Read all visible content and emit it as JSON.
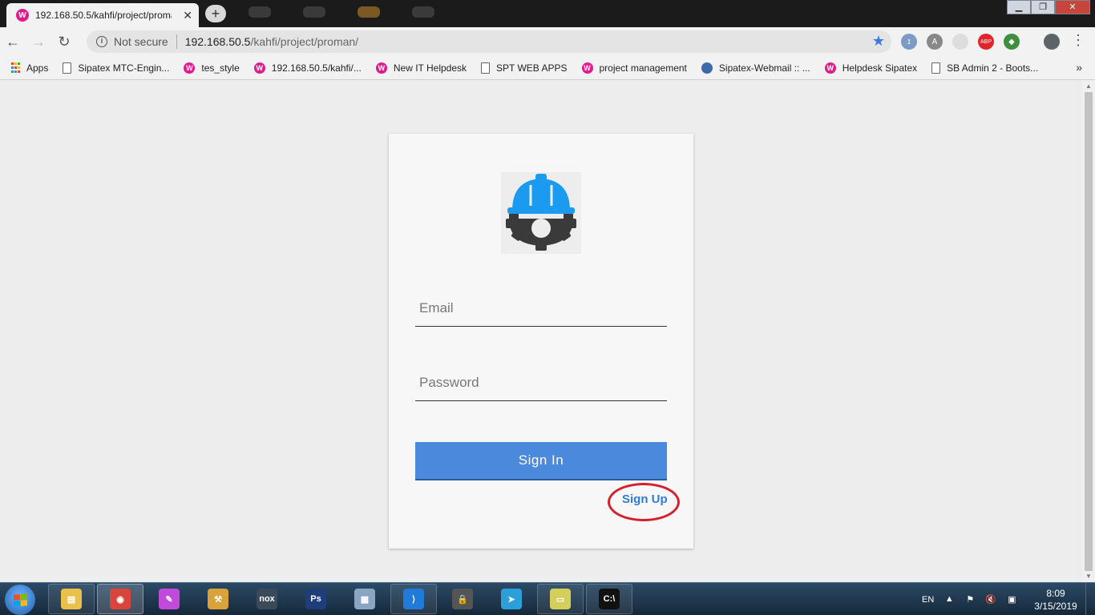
{
  "browser": {
    "tab": {
      "title": "192.168.50.5/kahfi/project/proman/",
      "favicon": "W",
      "close": "✕"
    },
    "new_tab": "+",
    "window_controls": {
      "minimize": "▁",
      "maximize": "❐",
      "close": "✕"
    },
    "nav": {
      "back": "←",
      "forward": "→",
      "reload": "↻"
    },
    "omnibox": {
      "info": "i",
      "security_label": "Not secure",
      "url_host": "192.168.50.5",
      "url_path": "/kahfi/project/proman/",
      "star": "★"
    },
    "extensions": [
      {
        "name": "extension-1-icon",
        "glyph": "ɪ",
        "color": "#7d9cc3"
      },
      {
        "name": "extension-angular-icon",
        "glyph": "A",
        "color": "#888888"
      },
      {
        "name": "extension-3-icon",
        "glyph": "",
        "color": "#dddddd"
      },
      {
        "name": "adblock-plus-icon",
        "glyph": "ABP",
        "color": "#e0262a"
      },
      {
        "name": "extension-5-icon",
        "glyph": "◆",
        "color": "#3f8d3f"
      }
    ],
    "menu": "⋮",
    "bookmarks": {
      "apps_label": "Apps",
      "items": [
        {
          "label": "Sipatex MTC-Engin...",
          "icon": "page"
        },
        {
          "label": "tes_style",
          "icon": "wamp"
        },
        {
          "label": "192.168.50.5/kahfi/...",
          "icon": "wamp"
        },
        {
          "label": "New IT Helpdesk",
          "icon": "wamp"
        },
        {
          "label": "SPT WEB APPS",
          "icon": "page"
        },
        {
          "label": "project management",
          "icon": "wamp"
        },
        {
          "label": "Sipatex-Webmail :: ...",
          "icon": "globe"
        },
        {
          "label": "Helpdesk Sipatex",
          "icon": "wamp"
        },
        {
          "label": "SB Admin 2 - Boots...",
          "icon": "page"
        }
      ],
      "more": "»"
    }
  },
  "login": {
    "logo_name": "hardhat-gear-logo",
    "logo_colors": {
      "helmet": "#1a9bef",
      "gear": "#3a3a3a"
    },
    "email_placeholder": "Email",
    "email_value": "",
    "password_placeholder": "Password",
    "password_value": "",
    "signin_label": "Sign In",
    "signup_label": "Sign Up",
    "accent": "#4a89dc",
    "annotation_color": "#d3202a"
  },
  "taskbar": {
    "items": [
      {
        "name": "file-explorer-icon",
        "glyph": "▤",
        "color": "#e8c04a",
        "state": "pinned"
      },
      {
        "name": "chrome-icon",
        "glyph": "◉",
        "color": "#d9453a",
        "state": "active"
      },
      {
        "name": "paint-icon",
        "glyph": "✎",
        "color": "#c04ad9",
        "state": ""
      },
      {
        "name": "tools-icon",
        "glyph": "⚒",
        "color": "#d9a23a",
        "state": ""
      },
      {
        "name": "nox-icon",
        "glyph": "nox",
        "color": "#3a4a5a",
        "state": ""
      },
      {
        "name": "photoshop-icon",
        "glyph": "Ps",
        "color": "#1e3d7a",
        "state": ""
      },
      {
        "name": "calculator-icon",
        "glyph": "▦",
        "color": "#8aa4c4",
        "state": ""
      },
      {
        "name": "visual-studio-code-icon",
        "glyph": "⟩",
        "color": "#1f7ad8",
        "state": "pinned"
      },
      {
        "name": "security-tool-icon",
        "glyph": "🔒",
        "color": "#555555",
        "state": ""
      },
      {
        "name": "telegram-icon",
        "glyph": "➤",
        "color": "#2a9fd8",
        "state": ""
      },
      {
        "name": "sticky-notes-icon",
        "glyph": "▭",
        "color": "#d4cf5a",
        "state": "pinned"
      },
      {
        "name": "command-prompt-icon",
        "glyph": "C:\\",
        "color": "#111111",
        "state": "pinned"
      }
    ],
    "language": "EN",
    "tray_up": "▲",
    "clock_time": "8:09",
    "clock_date": "3/15/2019"
  }
}
